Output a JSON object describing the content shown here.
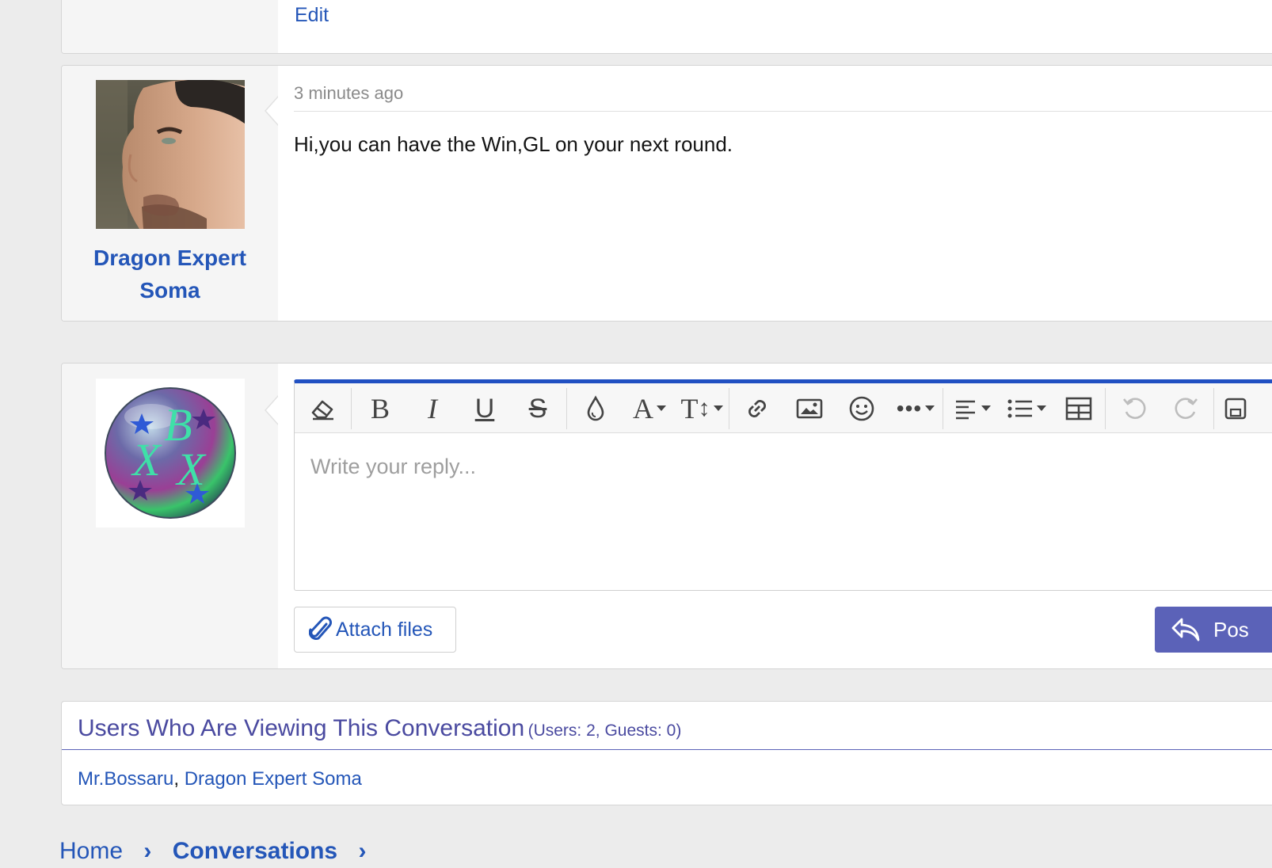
{
  "previous_message": {
    "edit_label": "Edit"
  },
  "message": {
    "date": "3 minutes ago",
    "body": "Hi,you can have the Win,GL on your next round.",
    "author_line1": "Dragon Expert",
    "author_line2": "Soma"
  },
  "reply": {
    "placeholder": "Write your reply...",
    "attach_label": "Attach files",
    "post_label": "Pos",
    "avatar_letters": [
      "B",
      "X",
      "X"
    ],
    "toolbar": [
      "eraser-icon",
      "bold-icon",
      "italic-icon",
      "underline-icon",
      "strikethrough-icon",
      "color-icon",
      "font-family-icon",
      "font-size-icon",
      "link-icon",
      "image-icon",
      "smilie-icon",
      "more-icon",
      "align-icon",
      "list-icon",
      "table-icon",
      "undo-icon",
      "redo-icon",
      "drafts-icon"
    ]
  },
  "viewers": {
    "title": "Users Who Are Viewing This Conversation",
    "counts": "(Users: 2, Guests: 0)",
    "users": [
      "Mr.Bossaru",
      "Dragon Expert Soma"
    ],
    "separator": ", "
  },
  "breadcrumb": [
    "Home",
    "Conversations"
  ],
  "colors": {
    "link": "#2456b8",
    "accent": "#2150c2",
    "button": "#5b62b8"
  }
}
